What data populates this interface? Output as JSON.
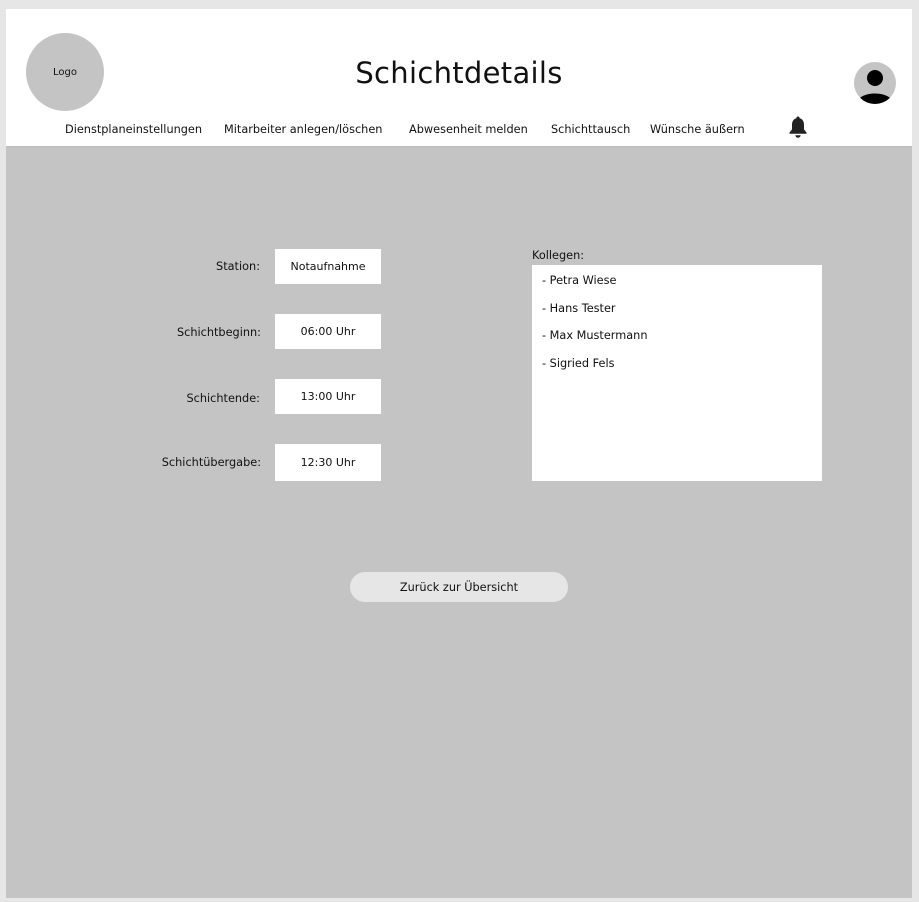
{
  "header": {
    "logo_label": "Logo",
    "title": "Schichtdetails",
    "nav": [
      {
        "label": "Dienstplaneinstellungen"
      },
      {
        "label": "Mitarbeiter anlegen/löschen"
      },
      {
        "label": "Abwesenheit melden"
      },
      {
        "label": "Schichttausch"
      },
      {
        "label": "Wünsche äußern"
      }
    ],
    "icons": {
      "notifications": "bell-icon",
      "profile": "user-icon"
    }
  },
  "details": {
    "station": {
      "label": "Station:",
      "value": "Notaufnahme"
    },
    "start": {
      "label": "Schichtbeginn:",
      "value": "06:00 Uhr"
    },
    "end": {
      "label": "Schichtende:",
      "value": "13:00 Uhr"
    },
    "handover": {
      "label": "Schichtübergabe:",
      "value": "12:30 Uhr"
    }
  },
  "colleagues": {
    "label": "Kollegen:",
    "items": [
      "- Petra Wiese",
      "- Hans Tester",
      "- Max Mustermann",
      "- Sigried Fels"
    ]
  },
  "actions": {
    "back_label": "Zurück zur Übersicht"
  },
  "colors": {
    "background": "#c4c4c4",
    "header": "#ffffff",
    "button": "#e6e6e6"
  }
}
